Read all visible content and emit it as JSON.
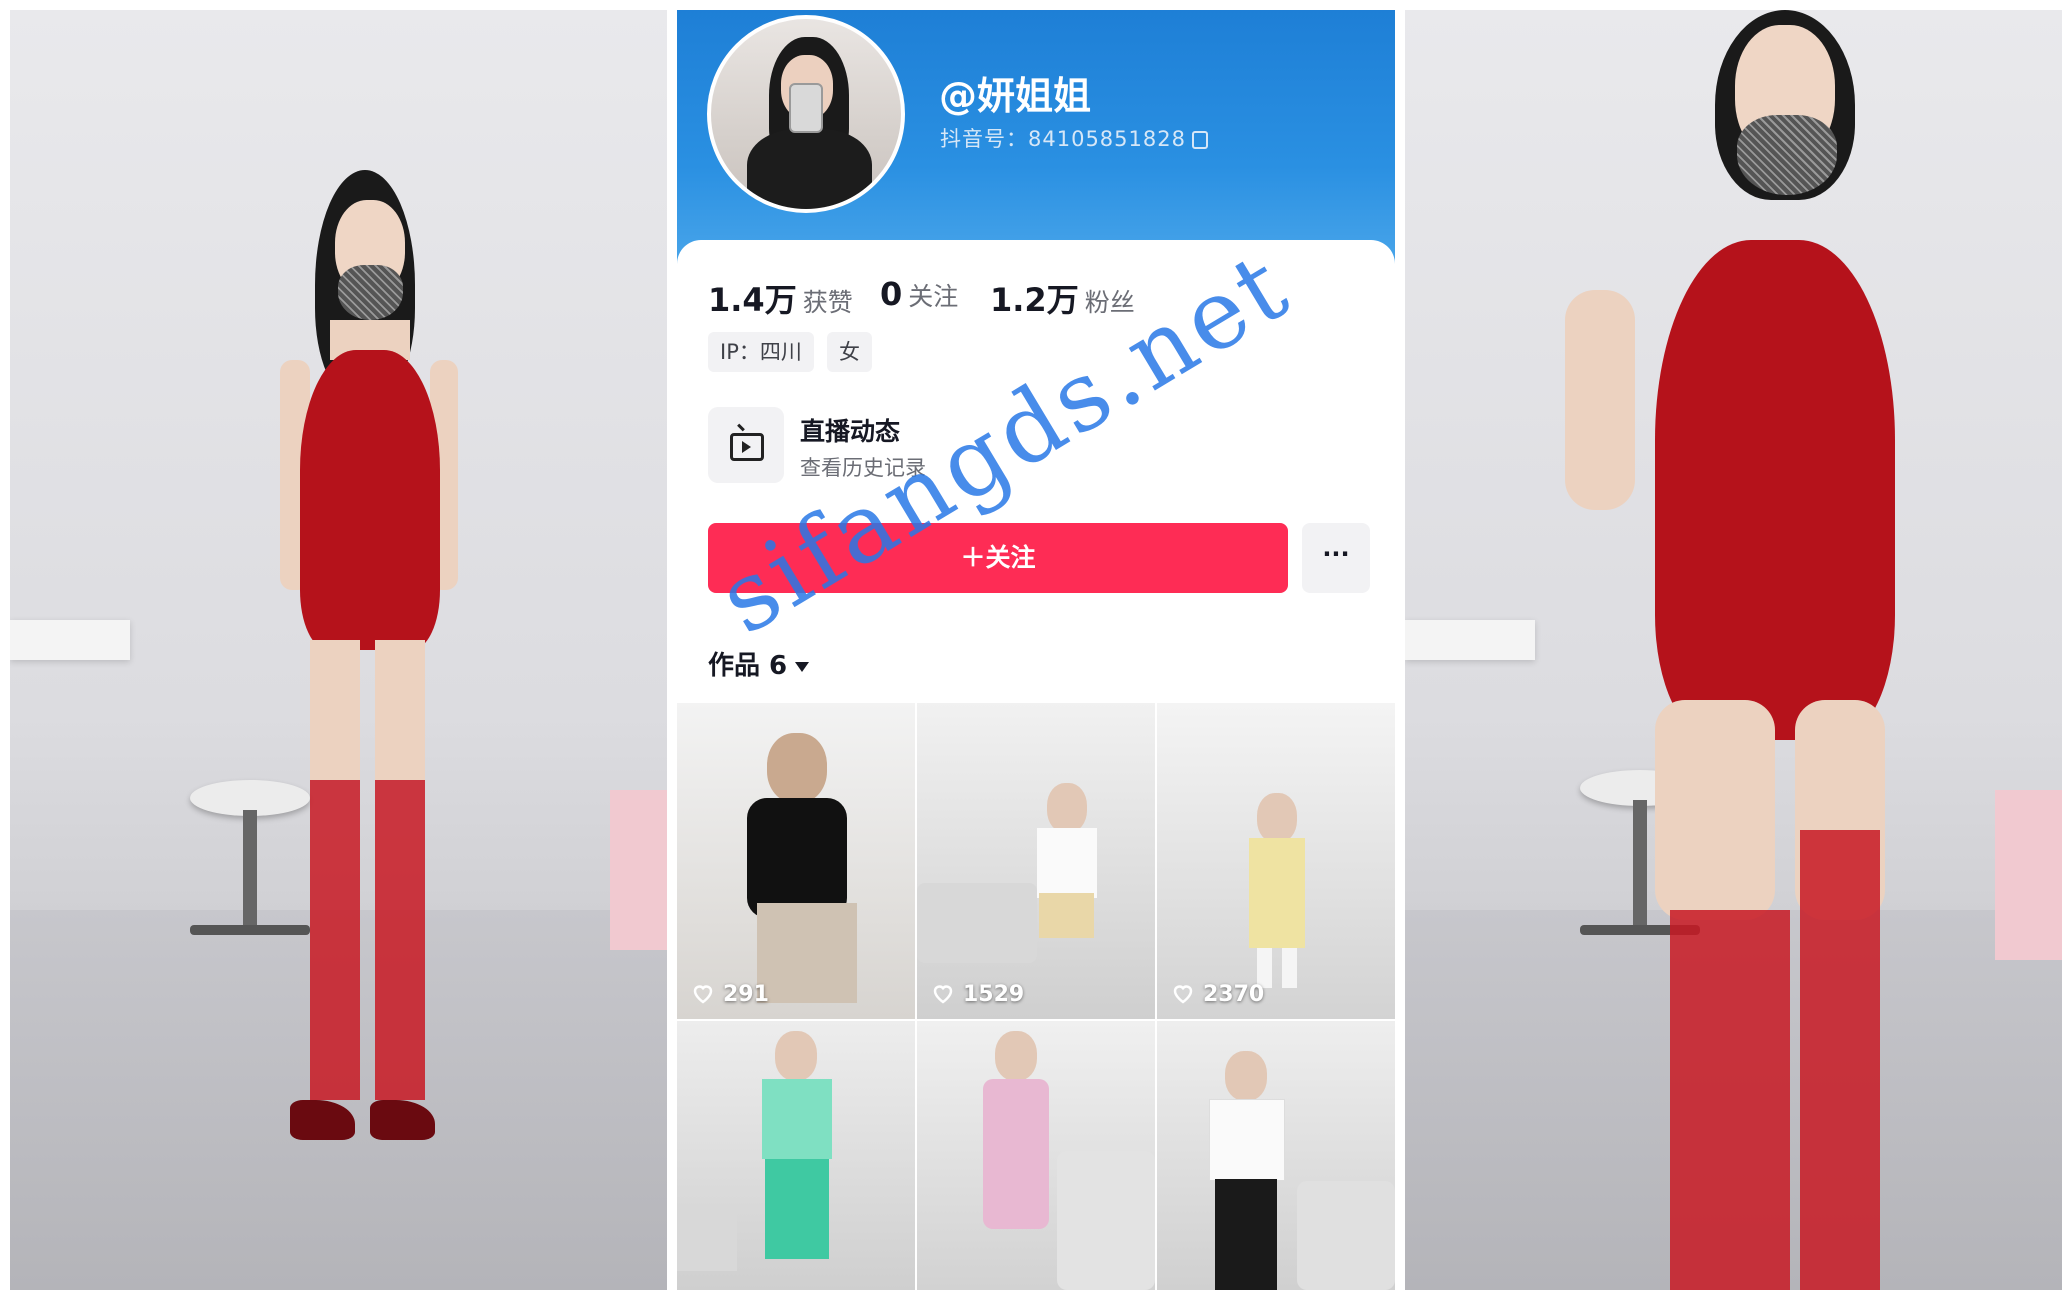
{
  "profile": {
    "username": "@妍姐姐",
    "douyin_id": "抖音号：84105851828",
    "stats": [
      {
        "value": "1.4万",
        "label": "获赞"
      },
      {
        "value": "0",
        "label": "关注"
      },
      {
        "value": "1.2万",
        "label": "粉丝"
      }
    ],
    "tags": [
      "IP：四川",
      "女"
    ],
    "live": {
      "title": "直播动态",
      "subtitle": "查看历史记录",
      "icon": "tv-icon"
    },
    "follow_label": "＋关注",
    "more_label": "···",
    "works_tab": "作品 6"
  },
  "videos": [
    {
      "likes": "291"
    },
    {
      "likes": "1529"
    },
    {
      "likes": "2370"
    },
    {
      "likes": ""
    },
    {
      "likes": ""
    },
    {
      "likes": ""
    }
  ],
  "watermark": "sifangds.net",
  "colors": {
    "header_blue": "#1e7fd6",
    "follow_red": "#fe2c55",
    "watermark_blue": "#2878e6"
  }
}
